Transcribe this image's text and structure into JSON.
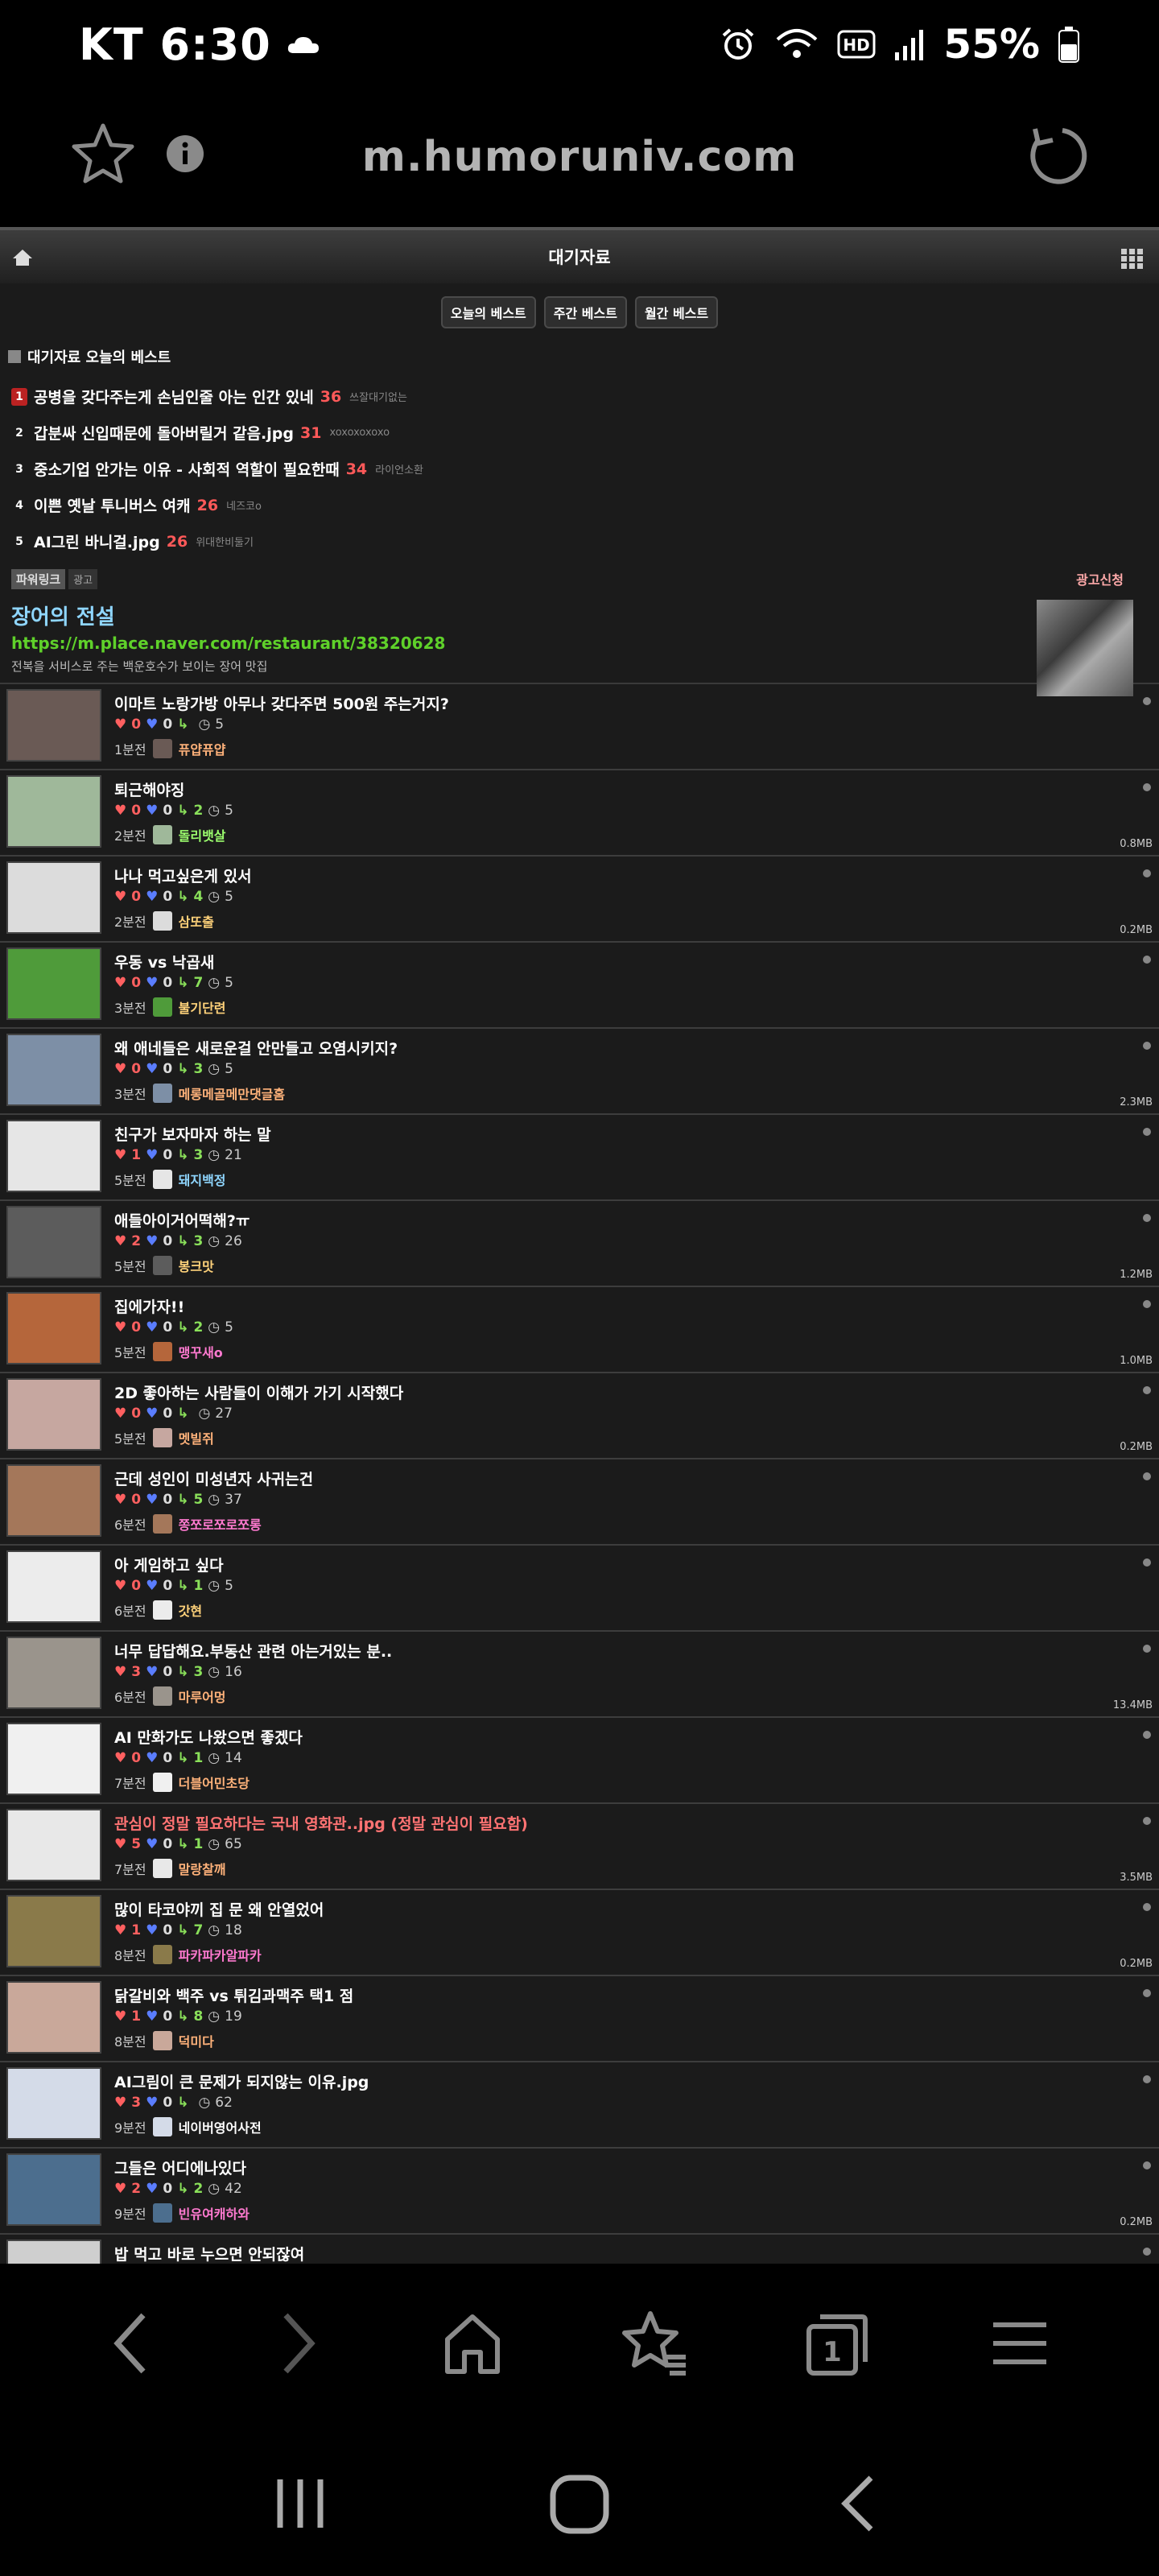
{
  "status": {
    "carrier_time": "KT 6:30",
    "battery": "55%"
  },
  "browser": {
    "url": "m.humoruniv.com"
  },
  "site": {
    "title": "대기자료",
    "tabs": [
      "오늘의 베스트",
      "주간 베스트",
      "월간 베스트"
    ],
    "best_title": "대기자료 오늘의 베스트"
  },
  "best": [
    {
      "rank": "1",
      "title": "공병을 갖다주는게 손님인줄 아는 인간 있네",
      "count": "36",
      "author": "쓰잘대기없는"
    },
    {
      "rank": "2",
      "title": "갑분싸 신입때문에 돌아버릴거 같음.jpg",
      "count": "31",
      "author": "xoxoxoxoxo"
    },
    {
      "rank": "3",
      "title": "중소기업 안가는 이유 - 사회적 역할이 필요한때",
      "count": "34",
      "author": "라이언소환"
    },
    {
      "rank": "4",
      "title": "이쁜 옛날 투니버스 여캐",
      "count": "26",
      "author": "네즈코o"
    },
    {
      "rank": "5",
      "title": "AI그린 바니걸.jpg",
      "count": "26",
      "author": "위대한비둘기"
    }
  ],
  "ad": {
    "label": "파워링크",
    "label2": "광고",
    "apply": "광고신청",
    "title": "장어의 전설",
    "url": "https://m.place.naver.com/restaurant/38320628",
    "desc": "전복을 서비스로 주는 백운호수가 보이는 장어 맛집"
  },
  "posts": [
    {
      "title": "이마트 노랑가방 아무나 갖다주면 500원 주는거지?",
      "up": "0",
      "down": "0",
      "comments": "",
      "views": "5",
      "time": "1분전",
      "author": "퓨얍퓨얍",
      "author_color": "#ffb27a",
      "size": "",
      "hot": false,
      "thumb": "#6a5a55"
    },
    {
      "title": "퇴근해야징",
      "up": "0",
      "down": "0",
      "comments": "2",
      "views": "5",
      "time": "2분전",
      "author": "돌리뱃살",
      "author_color": "#9cff6e",
      "size": "0.8MB",
      "hot": false,
      "thumb": "#9fb89a"
    },
    {
      "title": "나나 먹고싶은게 있서",
      "up": "0",
      "down": "0",
      "comments": "4",
      "views": "5",
      "time": "2분전",
      "author": "삼또출",
      "author_color": "#ffd27a",
      "size": "0.2MB",
      "hot": false,
      "thumb": "#dcdcdc"
    },
    {
      "title": "우동 vs 낙곱새",
      "up": "0",
      "down": "0",
      "comments": "7",
      "views": "5",
      "time": "3분전",
      "author": "불기단련",
      "author_color": "#ffd27a",
      "size": "",
      "hot": false,
      "thumb": "#4f9b3a"
    },
    {
      "title": "왜 애네들은 새로운걸 안만들고 오염시키지?",
      "up": "0",
      "down": "0",
      "comments": "3",
      "views": "5",
      "time": "3분전",
      "author": "메롱메골메만댓글홈",
      "author_color": "#ffb27a",
      "size": "2.3MB",
      "hot": false,
      "thumb": "#7d8fa6"
    },
    {
      "title": "친구가 보자마자 하는 말",
      "up": "1",
      "down": "0",
      "comments": "3",
      "views": "21",
      "time": "5분전",
      "author": "돼지백정",
      "author_color": "#8fd6ff",
      "size": "",
      "hot": false,
      "thumb": "#e6e6e6"
    },
    {
      "title": "애들아이거어떡해?ㅠ",
      "up": "2",
      "down": "0",
      "comments": "3",
      "views": "26",
      "time": "5분전",
      "author": "봉크맛",
      "author_color": "#ffd27a",
      "size": "1.2MB",
      "hot": false,
      "thumb": "#5c5c5c"
    },
    {
      "title": "집에가자!!",
      "up": "0",
      "down": "0",
      "comments": "2",
      "views": "5",
      "time": "5분전",
      "author": "맹꾸새o",
      "author_color": "#ff7ad0",
      "size": "1.0MB",
      "hot": false,
      "thumb": "#b5663b"
    },
    {
      "title": "2D 좋아하는 사람들이 이해가 가기 시작했다",
      "up": "0",
      "down": "0",
      "comments": "",
      "views": "27",
      "time": "5분전",
      "author": "멧빌쥐",
      "author_color": "#ffb27a",
      "size": "0.2MB",
      "hot": false,
      "thumb": "#c6a7a0"
    },
    {
      "title": "근데 성인이 미성년자 사귀는건",
      "up": "0",
      "down": "0",
      "comments": "5",
      "views": "37",
      "time": "6분전",
      "author": "쫑쪼로쪼로쪼롱",
      "author_color": "#ff7ad0",
      "size": "",
      "hot": false,
      "thumb": "#a4775a"
    },
    {
      "title": "아 게임하고 싶다",
      "up": "0",
      "down": "0",
      "comments": "1",
      "views": "5",
      "time": "6분전",
      "author": "갓현",
      "author_color": "#ffd27a",
      "size": "",
      "hot": false,
      "thumb": "#ececec"
    },
    {
      "title": "너무 답답해요.부동산 관련 아는거있는 분..",
      "up": "3",
      "down": "0",
      "comments": "3",
      "views": "16",
      "time": "6분전",
      "author": "마루어멍",
      "author_color": "#ffb27a",
      "size": "13.4MB",
      "hot": false,
      "thumb": "#9a948c"
    },
    {
      "title": "AI 만화가도 나왔으면 좋겠다",
      "up": "0",
      "down": "0",
      "comments": "1",
      "views": "14",
      "time": "7분전",
      "author": "더블어민초당",
      "author_color": "#ffb27a",
      "size": "",
      "hot": false,
      "thumb": "#f0f0f0"
    },
    {
      "title": "관심이 정말 필요하다는 국내 영화관..jpg (정말 관심이 필요함)",
      "up": "5",
      "down": "0",
      "comments": "1",
      "views": "65",
      "time": "7분전",
      "author": "말랑찰깨",
      "author_color": "#ffb27a",
      "size": "3.5MB",
      "hot": true,
      "thumb": "#e8e8e8"
    },
    {
      "title": "많이 타코야끼 집 문 왜 안열었어",
      "up": "1",
      "down": "0",
      "comments": "7",
      "views": "18",
      "time": "8분전",
      "author": "파카파카알파카",
      "author_color": "#ff7ad0",
      "size": "0.2MB",
      "hot": false,
      "thumb": "#8a7a4a"
    },
    {
      "title": "닭갈비와 백주 vs 튀김과맥주 택1 점",
      "up": "1",
      "down": "0",
      "comments": "8",
      "views": "19",
      "time": "8분전",
      "author": "덕미다",
      "author_color": "#ffb27a",
      "size": "",
      "hot": false,
      "thumb": "#c9a89a"
    },
    {
      "title": "AI그림이 큰 문제가 되지않는 이유.jpg",
      "up": "3",
      "down": "0",
      "comments": "",
      "views": "62",
      "time": "9분전",
      "author": "네이버영어사전",
      "author_color": "#ffffff",
      "size": "",
      "hot": false,
      "thumb": "#d4dbe8"
    },
    {
      "title": "그들은 어디에나있다",
      "up": "2",
      "down": "0",
      "comments": "2",
      "views": "42",
      "time": "9분전",
      "author": "빈유여캐하와",
      "author_color": "#ff7ad0",
      "size": "0.2MB",
      "hot": false,
      "thumb": "#4c6e8e"
    },
    {
      "title": "밥 먹고 바로 누으면 안되잖여",
      "up": "",
      "down": "",
      "comments": "",
      "views": "",
      "time": "",
      "author": "",
      "author_color": "#ffffff",
      "size": "",
      "hot": false,
      "thumb": "#cfcfcf"
    }
  ]
}
